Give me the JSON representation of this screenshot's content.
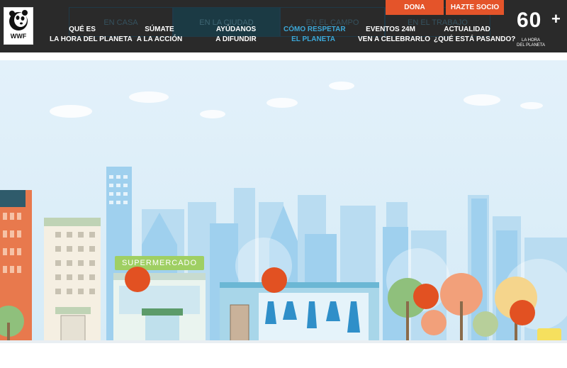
{
  "colors": {
    "header_bg": "#2a2a2a",
    "accent": "#e4542a",
    "active_nav": "#3ca8d8",
    "sky": "#e3f1fa"
  },
  "header": {
    "logo_text": "WWF",
    "subtabs": [
      "EN CASA",
      "EN LA CIUDAD",
      "EN EL CAMPO",
      "EN EL TRABAJO"
    ],
    "nav": [
      {
        "line1": "QUÉ ES",
        "line2": "LA HORA DEL PLANETA"
      },
      {
        "line1": "SÚMATE",
        "line2": "A LA ACCIÓN"
      },
      {
        "line1": "AYÚDANOS",
        "line2": "A DIFUNDIR"
      },
      {
        "line1": "CÓMO RESPETAR",
        "line2": "EL PLANETA"
      },
      {
        "line1": "EVENTOS 24M",
        "line2": "VEN A CELEBRARLO"
      },
      {
        "line1": "ACTUALIDAD",
        "line2": "¿QUÉ ESTÁ PASANDO?"
      }
    ],
    "donate_label": "DONA",
    "member_label": "HAZTE SOCIO",
    "badge": {
      "number": "60",
      "plus": "+",
      "caption_line1": "LA HORA",
      "caption_line2": "DEL PLANETA"
    }
  },
  "scene": {
    "supermarket_sign": "SUPERMERCADO",
    "hotspot_count": 5
  }
}
